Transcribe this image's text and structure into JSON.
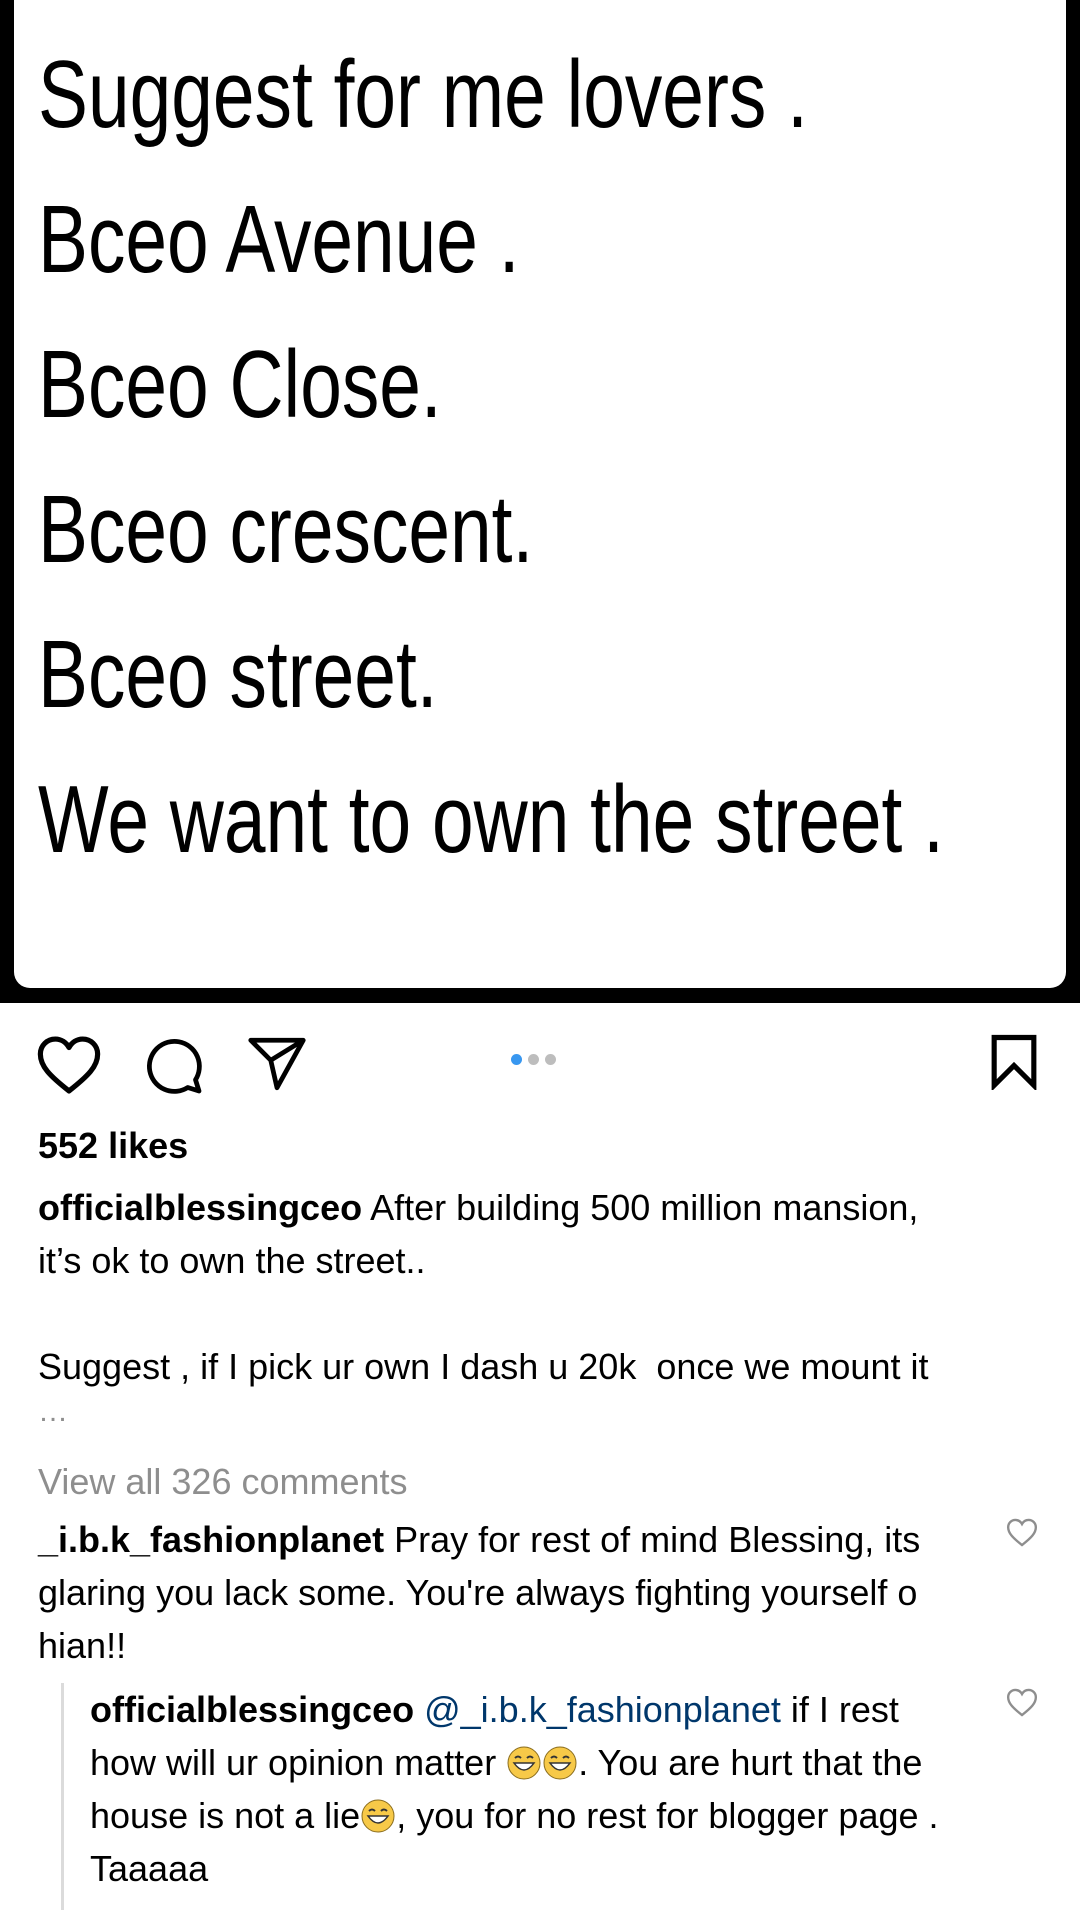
{
  "post_image": {
    "lines": [
      "Suggest for me lovers .",
      "Bceo Avenue .",
      "Bceo Close.",
      "Bceo crescent.",
      "Bceo street.",
      "We want to own the street ."
    ]
  },
  "actions": {
    "like_icon": "heart-outline-icon",
    "comment_icon": "comment-bubble-icon",
    "share_icon": "paper-plane-icon",
    "save_icon": "bookmark-icon",
    "carousel_dots": 3,
    "carousel_active": 1
  },
  "colors": {
    "accent": "#3897f0",
    "muted": "#8e8e8e",
    "mention": "#00376b"
  },
  "post": {
    "likes": "552 likes",
    "author": "officialblessingceo",
    "caption_line1": " After building 500 million mansion,",
    "caption_line2": "it’s ok to own the street..",
    "caption_line3": "Suggest , if I pick ur own I dash u 20k  once we mount it",
    "caption_more": "…",
    "view_all": "View all 326 comments"
  },
  "comments": [
    {
      "username": "_i.b.k_fashionplanet",
      "text": " Pray for rest of mind Blessing, its glaring you lack some. You're always fighting yourself o hian!!"
    },
    {
      "username": "officialblessingceo",
      "mention": "@_i.b.k_fashionplanet",
      "text_a": " if I rest how will ur opinion matter ",
      "text_b": ". You are hurt that the house is not a lie",
      "text_c": ", you for no rest for blogger page . Taaaaa",
      "emoji": "laughing-tears-emoji"
    }
  ]
}
